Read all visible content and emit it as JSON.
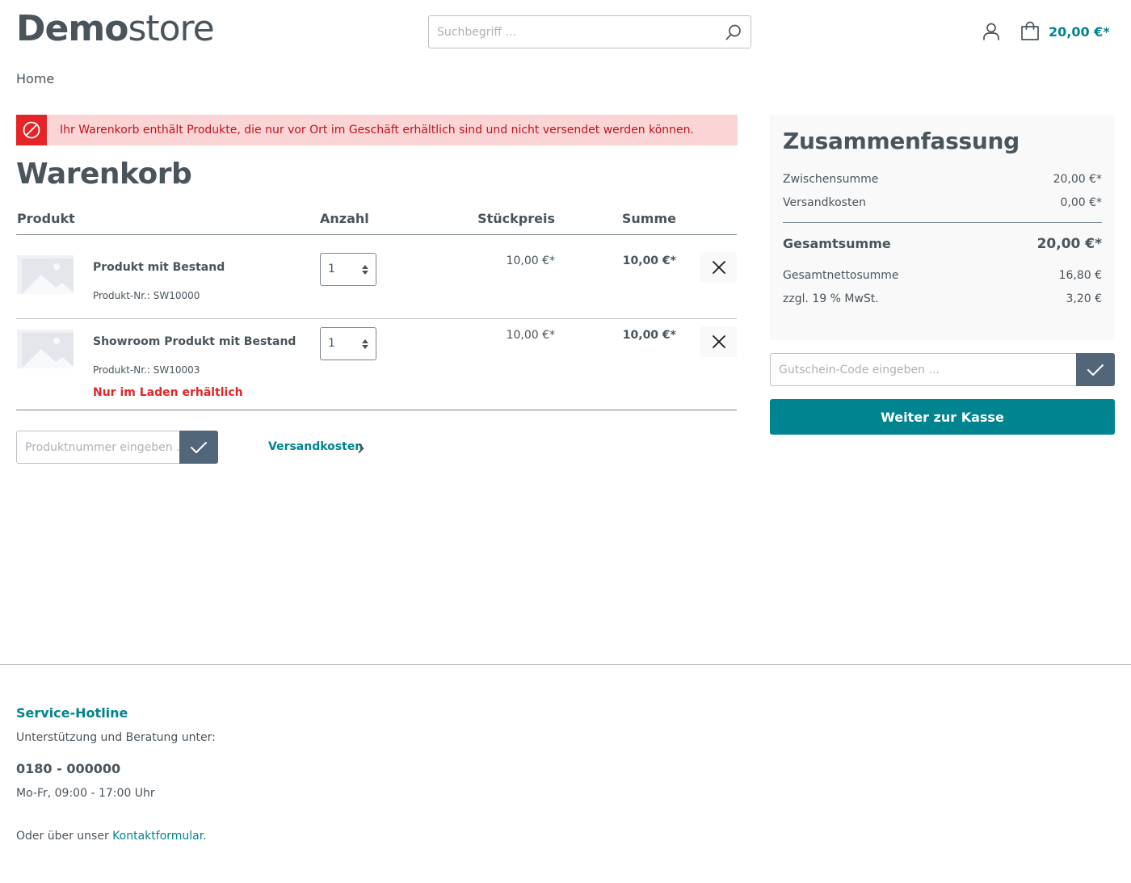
{
  "header": {
    "logo_bold": "Demo",
    "logo_light": "store",
    "search_placeholder": "Suchbegriff ...",
    "cart_total": "20,00 €*"
  },
  "breadcrumb": "Home",
  "alert": {
    "text": "Ihr Warenkorb enthält Produkte, die nur vor Ort im Geschäft erhältlich sind und nicht versendet werden können.",
    "color": "#e52427"
  },
  "page_title": "Warenkorb",
  "table": {
    "headers": [
      "Produkt",
      "Anzahl",
      "Stückpreis",
      "Summe"
    ],
    "rows": [
      {
        "name": "Produkt mit Bestand",
        "number": "Produkt-Nr.: SW10000",
        "quantity": "1",
        "unit_price": "10,00 €*",
        "total": "10,00 €*",
        "note": ""
      },
      {
        "name": "Showroom Produkt mit Bestand",
        "number": "Produkt-Nr.: SW10003",
        "quantity": "1",
        "unit_price": "10,00 €*",
        "total": "10,00 €*",
        "note": "Nur im Laden erhältlich"
      }
    ]
  },
  "product_number_placeholder": "Produktnummer eingeben ...",
  "shipping_link": "Versandkosten",
  "summary": {
    "title": "Zusammenfassung",
    "subtotal_label": "Zwischensumme",
    "subtotal_value": "20,00 €*",
    "shipping_label": "Versandkosten",
    "shipping_value": "0,00 €*",
    "total_label": "Gesamtsumme",
    "total_value": "20,00 €*",
    "net_label": "Gesamtnettosumme",
    "net_value": "16,80 €",
    "tax_label": "zzgl. 19 % MwSt.",
    "tax_value": "3,20 €"
  },
  "voucher_placeholder": "Gutschein-Code eingeben ...",
  "checkout_label": "Weiter zur Kasse",
  "footer": {
    "title": "Service-Hotline",
    "subtitle": "Unterstützung und Beratung unter:",
    "phone": "0180 - 000000",
    "hours": "Mo-Fr, 09:00 - 17:00 Uhr",
    "contact_prefix": "Oder über unser",
    "contact_link": "Kontaktformular",
    "contact_suffix": "."
  },
  "colors": {
    "brand": "#008490",
    "text": "#4a545b",
    "button": "#52667a",
    "danger": "#e52427"
  }
}
